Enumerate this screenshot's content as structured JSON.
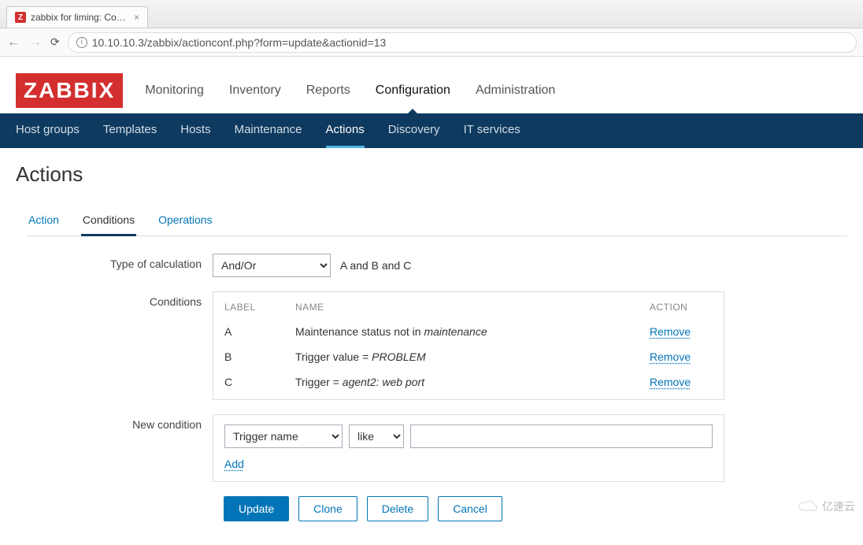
{
  "browser": {
    "tab_title": "zabbix for liming: Conf...",
    "url": "10.10.10.3/zabbix/actionconf.php?form=update&actionid=13"
  },
  "logo_text": "ZABBIX",
  "main_nav": [
    {
      "label": "Monitoring",
      "active": false
    },
    {
      "label": "Inventory",
      "active": false
    },
    {
      "label": "Reports",
      "active": false
    },
    {
      "label": "Configuration",
      "active": true
    },
    {
      "label": "Administration",
      "active": false
    }
  ],
  "sub_nav": [
    {
      "label": "Host groups",
      "active": false
    },
    {
      "label": "Templates",
      "active": false
    },
    {
      "label": "Hosts",
      "active": false
    },
    {
      "label": "Maintenance",
      "active": false
    },
    {
      "label": "Actions",
      "active": true
    },
    {
      "label": "Discovery",
      "active": false
    },
    {
      "label": "IT services",
      "active": false
    }
  ],
  "page_title": "Actions",
  "tabs": [
    {
      "label": "Action",
      "active": false
    },
    {
      "label": "Conditions",
      "active": true
    },
    {
      "label": "Operations",
      "active": false
    }
  ],
  "form": {
    "calc_label": "Type of calculation",
    "calc_select": "And/Or",
    "calc_expr": "A and B and C",
    "conditions_label": "Conditions",
    "headers": {
      "label": "LABEL",
      "name": "NAME",
      "action": "ACTION"
    },
    "rows": [
      {
        "label": "A",
        "name_plain": "Maintenance status not in ",
        "name_italic": "maintenance",
        "action": "Remove"
      },
      {
        "label": "B",
        "name_plain": "Trigger value = ",
        "name_italic": "PROBLEM",
        "action": "Remove"
      },
      {
        "label": "C",
        "name_plain": "Trigger = ",
        "name_italic": "agent2: web port",
        "action": "Remove"
      }
    ],
    "newcond_label": "New condition",
    "newcond_type": "Trigger name",
    "newcond_op": "like",
    "newcond_value": "",
    "add_label": "Add"
  },
  "buttons": {
    "update": "Update",
    "clone": "Clone",
    "delete": "Delete",
    "cancel": "Cancel"
  },
  "watermark": "亿速云"
}
